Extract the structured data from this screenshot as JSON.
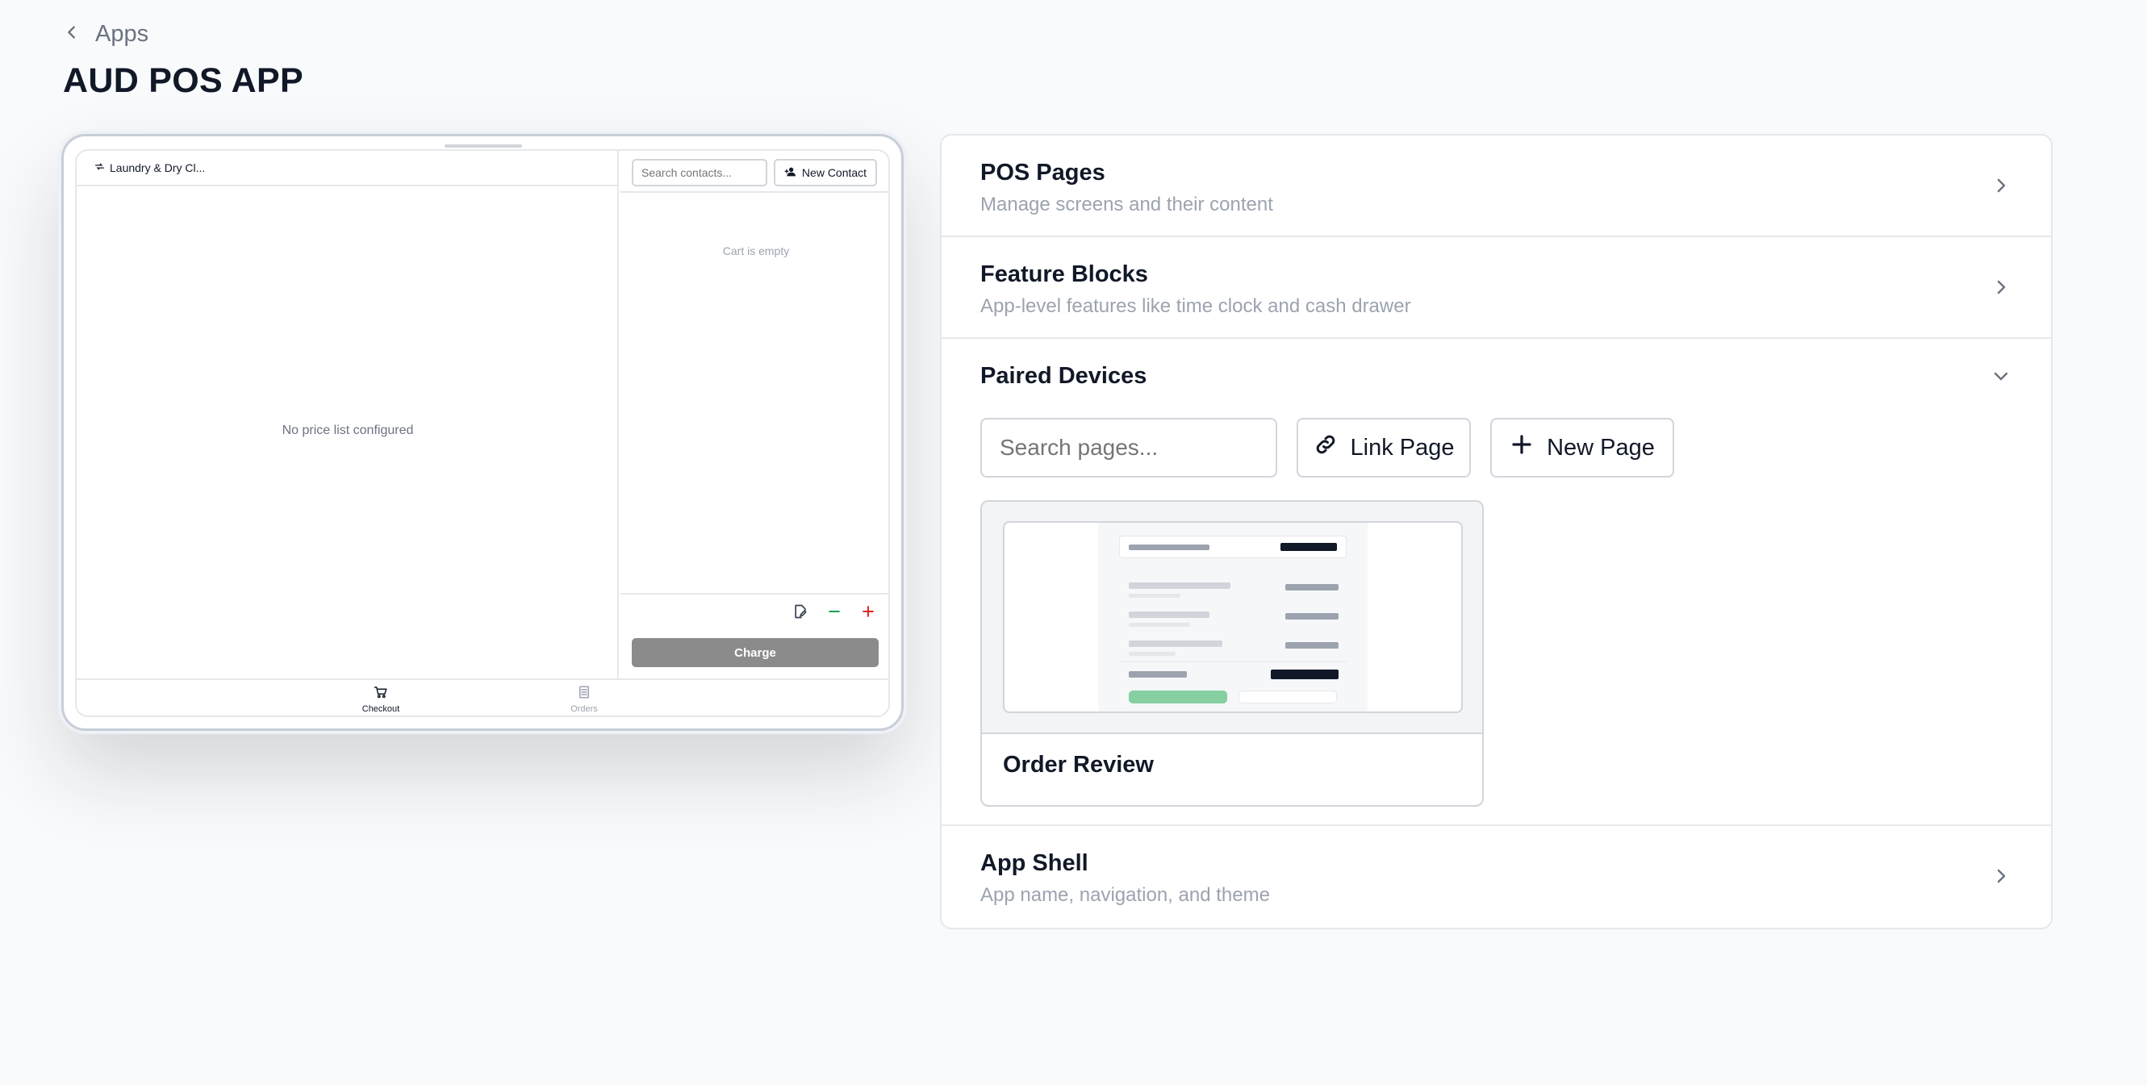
{
  "nav": {
    "back_label": "Apps"
  },
  "page": {
    "title": "AUD POS APP"
  },
  "preview": {
    "business_name": "Laundry & Dry Cl...",
    "price_list_message": "No price list configured",
    "search_placeholder": "Search contacts...",
    "new_contact_label": "New Contact",
    "cart_empty_message": "Cart is empty",
    "charge_label": "Charge",
    "tabs": [
      {
        "label": "Checkout",
        "icon": "cart-icon",
        "active": true
      },
      {
        "label": "Orders",
        "icon": "receipt-icon",
        "active": false
      }
    ]
  },
  "sections": {
    "pos_pages": {
      "title": "POS Pages",
      "description": "Manage screens and their content",
      "icon": "chevron-right-icon"
    },
    "feature_blocks": {
      "title": "Feature Blocks",
      "description": "App-level features like time clock and cash drawer",
      "icon": "chevron-right-icon"
    },
    "paired_devices": {
      "title": "Paired Devices",
      "icon": "chevron-down-icon",
      "search_placeholder": "Search pages...",
      "link_page_label": "Link Page",
      "new_page_label": "New Page",
      "pages": [
        {
          "name": "Order Review"
        }
      ]
    },
    "app_shell": {
      "title": "App Shell",
      "description": "App name, navigation, and theme",
      "icon": "chevron-right-icon"
    }
  },
  "colors": {
    "background": "#f9fafb",
    "text_primary": "#111827",
    "text_muted": "#9ca3af",
    "border": "#e5e7eb",
    "danger": "#dc2626",
    "success": "#16a34a",
    "charge_disabled": "#8b8b8b",
    "thumb_accent_green": "#86cfa0"
  }
}
